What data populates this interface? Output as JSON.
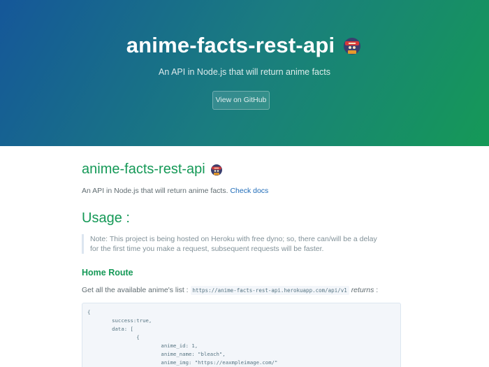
{
  "header": {
    "title": "anime-facts-rest-api",
    "tagline": "An API in Node.js that will return anime facts",
    "button_label": "View on GitHub"
  },
  "content": {
    "h1": "anime-facts-rest-api",
    "intro_text": "An API in Node.js that will return anime facts. ",
    "intro_link": "Check docs",
    "usage_heading": "Usage :",
    "note_text": "Note: This project is being hosted on Heroku with free dyno; so, there can/will be a delay for the first time you make a request, subsequent requests will be faster.",
    "home_route_heading": "Home Route",
    "list_text": "Get all the available anime's list : ",
    "list_code": "https://anime-facts-rest-api.herokuapp.com/api/v1",
    "list_returns": "returns",
    "list_colon": " :",
    "code_lines": "{\n        success:true,\n        data: [\n                {\n                        anime_id: 1,\n                        anime_name: \"bleach\",\n                        anime_img: \"https://eaxmpleimage.com/\"\n                },"
  },
  "colors": {
    "header_gradient_start": "#155799",
    "header_gradient_end": "#159957",
    "heading": "#159957",
    "link": "#1e6bb8",
    "text": "#606c71"
  },
  "icons": [
    "ninja-emoji-icon"
  ]
}
